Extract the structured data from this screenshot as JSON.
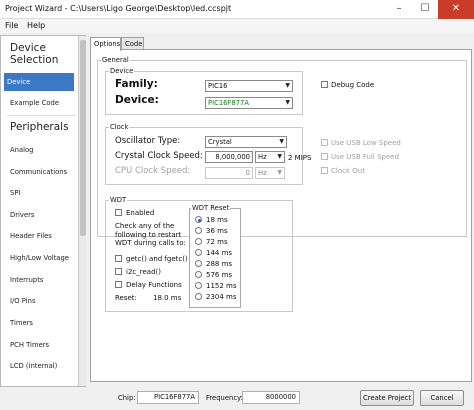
{
  "window": {
    "title": "Project Wizard - C:\\Users\\Ligo George\\Desktop\\led.ccspjt",
    "minimize_glyph": "–",
    "maximize_glyph": "☐",
    "close_glyph": "✕"
  },
  "menu": {
    "file": "File",
    "help": "Help"
  },
  "sidebar": {
    "device_header": "Device Selection",
    "device_items": [
      "Device",
      "Example Code"
    ],
    "peripherals_header": "Peripherals",
    "peripheral_items": [
      "Analog",
      "Communications",
      "SPI",
      "Drivers",
      "Header Files",
      "High/Low Voltage",
      "Interrupts",
      "I/O Pins",
      "Timers",
      "PCH Timers",
      "LCD (internal)"
    ]
  },
  "tabs": [
    "Options",
    "Code"
  ],
  "general": {
    "legend": "General",
    "device_group": {
      "legend": "Device",
      "family_label": "Family:",
      "family_value": "PIC16",
      "device_label": "Device:",
      "device_value": "PIC16F877A"
    },
    "debug_code": "Debug Code"
  },
  "clock": {
    "legend": "Clock",
    "osc_type_label": "Oscillator Type:",
    "osc_type_value": "Crystal",
    "crystal_speed_label": "Crystal Clock Speed:",
    "crystal_speed_value": "8,000,000",
    "crystal_unit": "Hz",
    "mips": "2 MIPS",
    "cpu_speed_label": "CPU Clock Speed:",
    "cpu_speed_value": "0",
    "cpu_unit": "Hz",
    "usb_low": "Use USB Low Speed",
    "usb_full": "Use USB Full Speed",
    "clock_out": "Clock Out"
  },
  "wdt": {
    "legend": "WDT",
    "enabled": "Enabled",
    "note": "Check any of the following to restart WDT during calls to:",
    "getc": "getc() and fgetc()",
    "i2c": "i2c_read()",
    "delay": "Delay Functions",
    "reset_label": "Reset:",
    "reset_value": "18.0 ms",
    "reset_list_legend": "WDT Reset",
    "reset_options": [
      "18 ms",
      "36 ms",
      "72 ms",
      "144 ms",
      "288 ms",
      "576 ms",
      "1152 ms",
      "2304 ms"
    ],
    "reset_selected": "18 ms"
  },
  "status": {
    "chip_label": "Chip:",
    "chip_value": "PIC16F877A",
    "freq_label": "Frequency:",
    "freq_value": "8000000",
    "create_button": "Create Project",
    "cancel_button": "Cancel"
  },
  "colors": {
    "selection": "#3c78c3",
    "close_button": "#c93c2a",
    "device_text": "#1a7a1a"
  }
}
